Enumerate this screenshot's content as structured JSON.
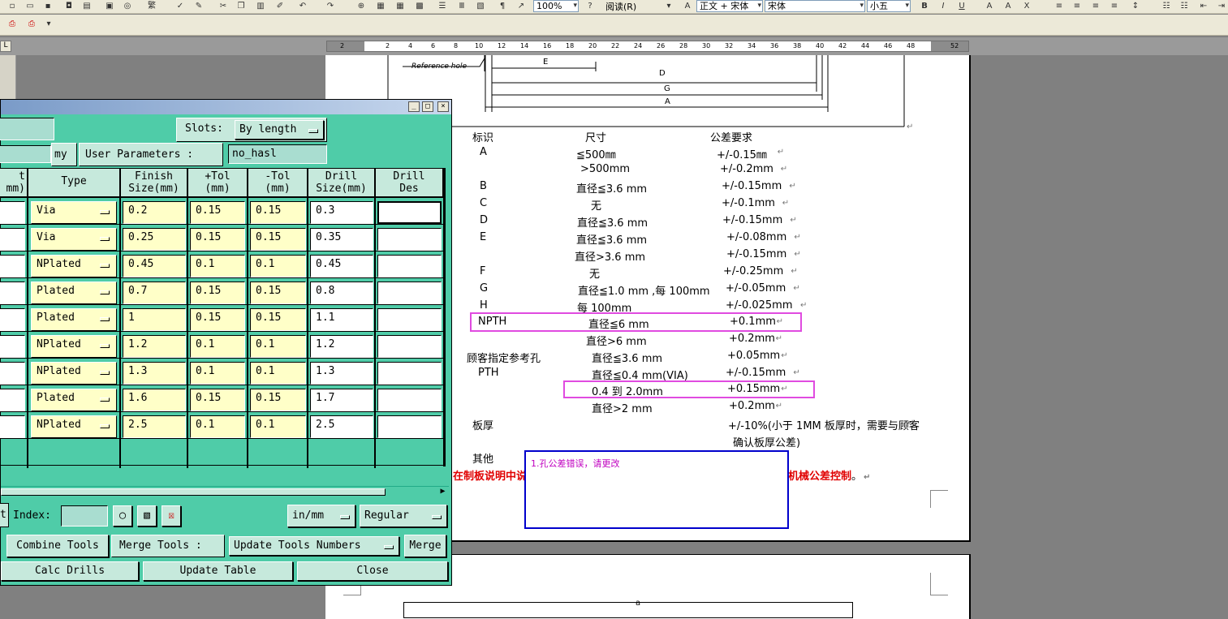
{
  "word": {
    "zoom": "100%",
    "read_label": "阅读(R)",
    "style": "正文 + 宋体",
    "font": "宋体",
    "size": "小五",
    "ruler_ticks": [
      "2",
      "2",
      "4",
      "6",
      "8",
      "10",
      "12",
      "14",
      "16",
      "18",
      "20",
      "22",
      "24",
      "26",
      "28",
      "30",
      "32",
      "34",
      "36",
      "38",
      "40",
      "42",
      "44",
      "46",
      "48",
      "52"
    ]
  },
  "doc": {
    "figure_labels": {
      "ref": "Reference hole",
      "E": "E",
      "D": "D",
      "G": "G",
      "A": "A"
    },
    "col_headers": {
      "mark": "标识",
      "size": "尺寸",
      "tol": "公差要求"
    },
    "rows": [
      {
        "mark": "A",
        "size": "≦500㎜",
        "tol": "+/-0.15㎜"
      },
      {
        "mark": "",
        "size": ">500mm",
        "tol": "+/-0.2mm"
      },
      {
        "mark": "B",
        "size": "直径≦3.6 mm",
        "tol": "+/-0.15mm"
      },
      {
        "mark": "C",
        "size": "无",
        "tol": "+/-0.1mm"
      },
      {
        "mark": "D",
        "size": "直径≦3.6 mm",
        "tol": "+/-0.15mm"
      },
      {
        "mark": "E",
        "size": "直径≦3.6 mm",
        "tol": "+/-0.08mm"
      },
      {
        "mark": "",
        "size": "直径>3.6 mm",
        "tol": "+/-0.15mm"
      },
      {
        "mark": "F",
        "size": "无",
        "tol": "+/-0.25mm"
      },
      {
        "mark": "G",
        "size": "直径≦1.0 mm ,每 100mm",
        "tol": "+/-0.05mm"
      },
      {
        "mark": "H",
        "size": "每 100mm",
        "tol": "+/-0.025mm"
      },
      {
        "mark": "NPTH",
        "size": "直径≦6 mm",
        "tol": "+0.1mm"
      },
      {
        "mark": "",
        "size": "直径>6 mm",
        "tol": "+0.2mm"
      },
      {
        "mark": "顾客指定参考孔",
        "size": "直径≦3.6 mm",
        "tol": "+0.05mm"
      },
      {
        "mark": "PTH",
        "size": "直径≦0.4 mm(VIA)",
        "tol": "+/-0.15mm"
      },
      {
        "mark": "",
        "size": "0.4 到 2.0mm",
        "tol": "+0.15mm"
      },
      {
        "mark": "",
        "size": "直径>2 mm",
        "tol": "+0.2mm"
      },
      {
        "mark": "板厚",
        "size": "",
        "tol": "+/-10%(小于  1MM  板厚时，需要与顾客"
      },
      {
        "mark": "",
        "size": "",
        "tol": "确认板厚公差)"
      }
    ],
    "other_label": "其他",
    "red_left": "在制板说明中说",
    "red_right": "机械公差控制",
    "red_end": "。",
    "comment": "1.孔公差错误，请更改",
    "page2_mark": "a"
  },
  "dialog": {
    "slots_label": "Slots:",
    "slots_value": "By length",
    "my_label": "my",
    "user_params_label": "User Parameters :",
    "user_params_value": "no_hasl",
    "headers": [
      "t\nmm)",
      "Type",
      "Finish\nSize(mm)",
      "+Tol\n(mm)",
      "-Tol\n(mm)",
      "Drill\nSize(mm)",
      "Drill\nDes"
    ],
    "rows": [
      {
        "type": "Via",
        "finish": "0.2",
        "ptol": "0.15",
        "ntol": "0.15",
        "drill": "0.3"
      },
      {
        "type": "Via",
        "finish": "0.25",
        "ptol": "0.15",
        "ntol": "0.15",
        "drill": "0.35"
      },
      {
        "type": "NPlated",
        "finish": "0.45",
        "ptol": "0.1",
        "ntol": "0.1",
        "drill": "0.45"
      },
      {
        "type": "Plated",
        "finish": "0.7",
        "ptol": "0.15",
        "ntol": "0.15",
        "drill": "0.8"
      },
      {
        "type": "Plated",
        "finish": "1",
        "ptol": "0.15",
        "ntol": "0.15",
        "drill": "1.1"
      },
      {
        "type": "NPlated",
        "finish": "1.2",
        "ptol": "0.1",
        "ntol": "0.1",
        "drill": "1.2"
      },
      {
        "type": "NPlated",
        "finish": "1.3",
        "ptol": "0.1",
        "ntol": "0.1",
        "drill": "1.3"
      },
      {
        "type": "Plated",
        "finish": "1.6",
        "ptol": "0.15",
        "ntol": "0.15",
        "drill": "1.7"
      },
      {
        "type": "NPlated",
        "finish": "2.5",
        "ptol": "0.1",
        "ntol": "0.1",
        "drill": "2.5"
      }
    ],
    "t_label": "t",
    "index_label": "Index:",
    "units": "in/mm",
    "mode": "Regular",
    "combine": "Combine Tools",
    "merge_label": "Merge Tools :",
    "update_numbers": "Update Tools Numbers",
    "merge": "Merge",
    "calc": "Calc Drills",
    "update_table": "Update Table",
    "close": "Close"
  }
}
